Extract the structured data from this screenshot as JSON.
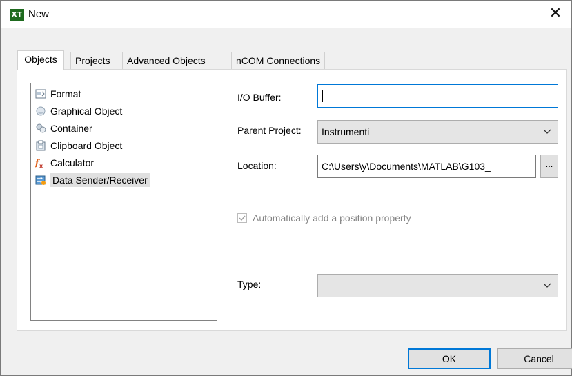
{
  "window": {
    "title": "New",
    "app_icon_text": "XT"
  },
  "tabs": [
    {
      "label": "Objects",
      "active": true
    },
    {
      "label": "Projects",
      "active": false
    },
    {
      "label": "Advanced Objects",
      "active": false
    },
    {
      "label": "nCOM Connections",
      "active": false
    }
  ],
  "object_list": [
    {
      "label": "Format",
      "icon": "format-icon",
      "selected": false
    },
    {
      "label": "Graphical Object",
      "icon": "graphical-object-icon",
      "selected": false
    },
    {
      "label": "Container",
      "icon": "container-icon",
      "selected": false
    },
    {
      "label": "Clipboard Object",
      "icon": "clipboard-object-icon",
      "selected": false
    },
    {
      "label": "Calculator",
      "icon": "calculator-icon",
      "selected": false
    },
    {
      "label": "Data Sender/Receiver",
      "icon": "data-sender-receiver-icon",
      "selected": true
    }
  ],
  "form": {
    "io_buffer_label": "I/O Buffer:",
    "io_buffer_value": "",
    "parent_project_label": "Parent Project:",
    "parent_project_value": "Instrumenti",
    "location_label": "Location:",
    "location_value": "C:\\Users\\y\\Documents\\MATLAB\\G103_",
    "browse_label": "...",
    "auto_position_label": "Automatically add a position property",
    "auto_position_checked": true,
    "auto_position_enabled": false,
    "type_label": "Type:",
    "type_value": ""
  },
  "buttons": {
    "ok": "OK",
    "cancel": "Cancel"
  },
  "colors": {
    "focus_blue": "#0078d7",
    "selection_gray": "#e0e0e0",
    "dialog_bg": "#f0f0f0"
  }
}
